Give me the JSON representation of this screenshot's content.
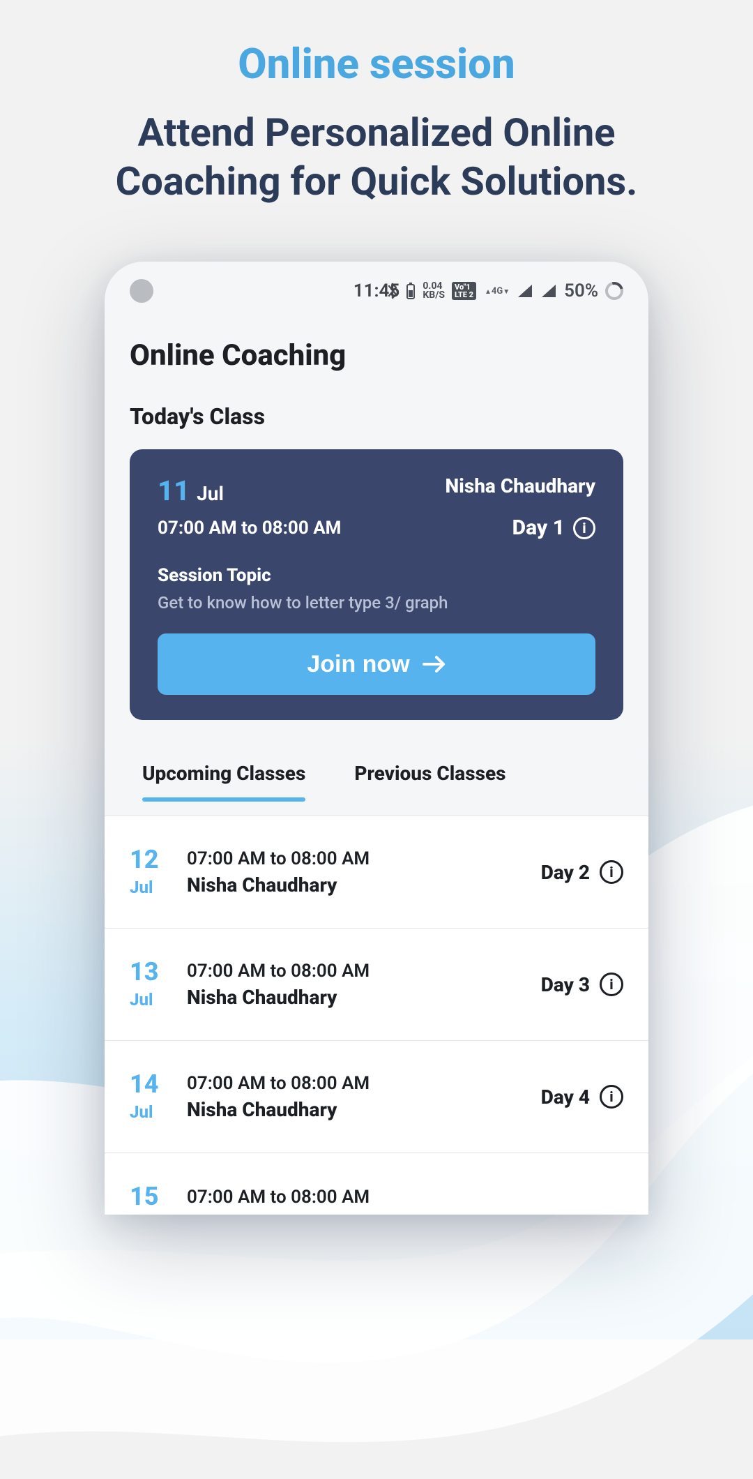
{
  "header": {
    "title": "Online session",
    "subtitle": "Attend Personalized Online Coaching for Quick Solutions."
  },
  "statusbar": {
    "time": "11:45",
    "data_rate": "0.04",
    "data_unit": "KB/S",
    "lte_top": "Vo\"1",
    "lte_bottom": "LTE 2",
    "net_label": "4G",
    "battery_pct": "50%"
  },
  "page": {
    "title": "Online Coaching",
    "today_section": "Today's Class"
  },
  "today": {
    "date_num": "11",
    "date_mon": "Jul",
    "time": "07:00 AM to 08:00 AM",
    "instructor": "Nisha Chaudhary",
    "day_label": "Day 1",
    "topic_label": "Session Topic",
    "topic_desc": "Get to know how to letter type 3/ graph",
    "join_label": "Join now"
  },
  "tabs": {
    "upcoming": "Upcoming Classes",
    "previous": "Previous Classes"
  },
  "classes": [
    {
      "date_num": "12",
      "date_mon": "Jul",
      "time": "07:00 AM to 08:00 AM",
      "instructor": "Nisha Chaudhary",
      "day_label": "Day 2"
    },
    {
      "date_num": "13",
      "date_mon": "Jul",
      "time": "07:00 AM to 08:00 AM",
      "instructor": "Nisha Chaudhary",
      "day_label": "Day 3"
    },
    {
      "date_num": "14",
      "date_mon": "Jul",
      "time": "07:00 AM to 08:00 AM",
      "instructor": "Nisha Chaudhary",
      "day_label": "Day 4"
    },
    {
      "date_num": "15",
      "date_mon": "",
      "time": "07:00 AM to 08:00 AM",
      "instructor": "",
      "day_label": ""
    }
  ],
  "colors": {
    "accent": "#56b3ee",
    "card": "#3a466b",
    "text_dark": "#1c1f23"
  }
}
